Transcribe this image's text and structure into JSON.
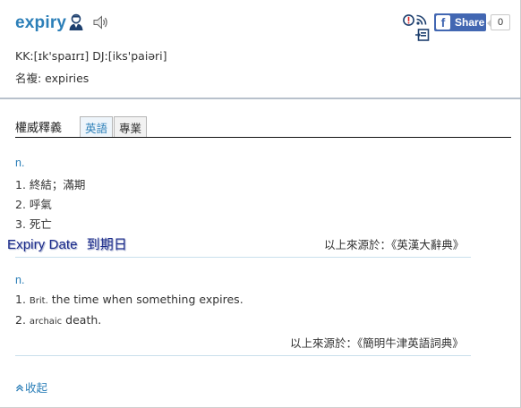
{
  "header": {
    "word": "expiry",
    "pronunciation": "KK:[ɪk'spaɪrɪ] DJ:[iks'paiəri]",
    "plural": "名複: expiries",
    "share_label": "Share",
    "share_count": "0",
    "fb_letter": "f"
  },
  "tabs": {
    "title": "權威釋義",
    "items": [
      {
        "label": "英語",
        "active": true
      },
      {
        "label": "專業",
        "active": false
      }
    ]
  },
  "section1": {
    "pos": "n.",
    "definitions": [
      "1. 終結；滿期",
      "2. 呼氣",
      "3. 死亡"
    ],
    "source": "以上來源於：《英漢大辭典》"
  },
  "overlay": {
    "english": "Expiry Date",
    "chinese": "到期日"
  },
  "section2": {
    "pos": "n.",
    "def1_num": "1.",
    "def1_label": "Brit.",
    "def1_text": "the time when something expires.",
    "def2_num": "2.",
    "def2_label": "archaic",
    "def2_text": "death.",
    "source": "以上來源於：《簡明牛津英語詞典》"
  },
  "collapse_label": "收起",
  "colors": {
    "accent": "#2c7fb8",
    "facebook": "#4267b2",
    "overlay_text": "#1a2a8a"
  },
  "icons": [
    "person-icon",
    "speaker-icon",
    "warning-icon",
    "rss-icon",
    "message-icon",
    "collapse-icon"
  ]
}
